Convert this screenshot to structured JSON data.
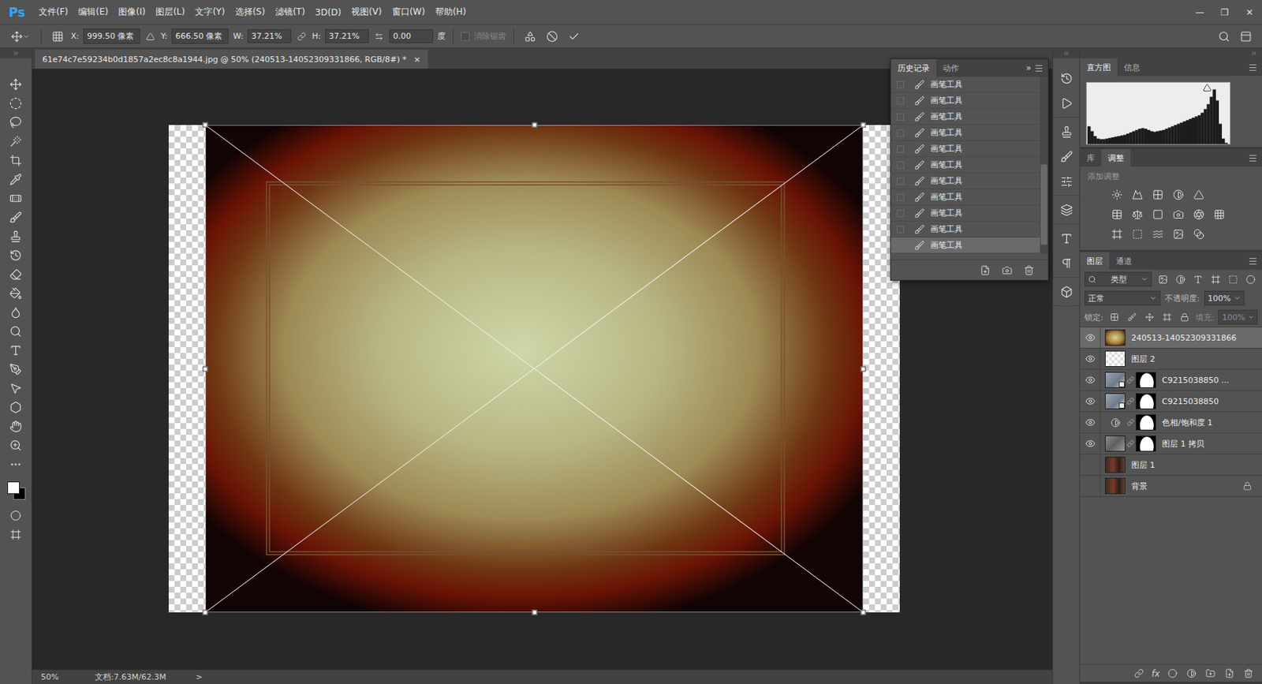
{
  "app": {
    "logo": "Ps",
    "window_controls": [
      "—",
      "❐",
      "✕"
    ]
  },
  "menu": [
    "文件(F)",
    "编辑(E)",
    "图像(I)",
    "图层(L)",
    "文字(Y)",
    "选择(S)",
    "滤镜(T)",
    "3D(D)",
    "视图(V)",
    "窗口(W)",
    "帮助(H)"
  ],
  "options_bar": {
    "x_label": "X:",
    "x": "999.50 像素",
    "y_label": "Y:",
    "y": "666.50 像素",
    "w_label": "W:",
    "w": "37.21%",
    "h_label": "H:",
    "h": "37.21%",
    "angle": "0.00",
    "angle_unit": "度",
    "antialias": {
      "label": "消除锯齿",
      "checked": false,
      "disabled": true
    }
  },
  "document": {
    "tab": "61e74c7e59234b0d1857a2ec8c8a1944.jpg @ 50% (240513-14052309331866, RGB/8#) *",
    "close": "×",
    "zoom": "50%",
    "doc_info": "文档:7.63M/62.3M",
    "arrow": ">"
  },
  "history_panel": {
    "tabs": [
      {
        "label": "历史记录",
        "selected": true
      },
      {
        "label": "动作",
        "selected": false
      }
    ],
    "expand": "»",
    "items": [
      {
        "label": "画笔工具",
        "selected": false
      },
      {
        "label": "画笔工具",
        "selected": false
      },
      {
        "label": "画笔工具",
        "selected": false
      },
      {
        "label": "画笔工具",
        "selected": false
      },
      {
        "label": "画笔工具",
        "selected": false
      },
      {
        "label": "画笔工具",
        "selected": false
      },
      {
        "label": "画笔工具",
        "selected": false
      },
      {
        "label": "画笔工具",
        "selected": false
      },
      {
        "label": "画笔工具",
        "selected": false
      },
      {
        "label": "画笔工具",
        "selected": false
      },
      {
        "label": "画笔工具",
        "selected": true
      }
    ]
  },
  "histogram_panel": {
    "tabs": [
      {
        "label": "直方图",
        "selected": true
      },
      {
        "label": "信息",
        "selected": false
      }
    ],
    "values": [
      30,
      22,
      14,
      10,
      9,
      9,
      10,
      11,
      12,
      13,
      14,
      15,
      16,
      18,
      20,
      22,
      24,
      26,
      27,
      26,
      24,
      22,
      21,
      22,
      23,
      24,
      26,
      28,
      30,
      32,
      34,
      36,
      38,
      40,
      42,
      44,
      46,
      48,
      52,
      58,
      66,
      78,
      90,
      72,
      34,
      10,
      3,
      0
    ]
  },
  "adjustments_panel": {
    "tabs": [
      {
        "label": "库",
        "selected": false
      },
      {
        "label": "调整",
        "selected": true
      }
    ],
    "hint": "添加调整"
  },
  "layers_panel": {
    "tabs": [
      {
        "label": "图层",
        "selected": true
      },
      {
        "label": "通道",
        "selected": false
      }
    ],
    "filter": "类型",
    "blend_mode": "正常",
    "opacity_label": "不透明度:",
    "opacity": "100%",
    "lock_label": "锁定:",
    "fill_label": "填充:",
    "fill": "100%",
    "fx": "fx",
    "layers": [
      {
        "name": "240513-14052309331866",
        "visible": true,
        "selected": true,
        "kind": "image",
        "mask": false,
        "locked": false
      },
      {
        "name": "图层 2",
        "visible": true,
        "selected": false,
        "kind": "empty",
        "mask": false,
        "locked": false
      },
      {
        "name": "C9215038850 ...",
        "visible": true,
        "selected": false,
        "kind": "smart",
        "mask": true,
        "locked": false
      },
      {
        "name": "C9215038850",
        "visible": true,
        "selected": false,
        "kind": "smart",
        "mask": true,
        "locked": false
      },
      {
        "name": "色相/饱和度 1",
        "visible": true,
        "selected": false,
        "kind": "adjustment",
        "mask": true,
        "locked": false
      },
      {
        "name": "图层 1 拷贝",
        "visible": true,
        "selected": false,
        "kind": "texture",
        "mask": true,
        "locked": false
      },
      {
        "name": "图层 1",
        "visible": false,
        "selected": false,
        "kind": "photo",
        "mask": false,
        "locked": false
      },
      {
        "name": "背景",
        "visible": false,
        "selected": false,
        "kind": "photo",
        "mask": false,
        "locked": true
      }
    ]
  }
}
